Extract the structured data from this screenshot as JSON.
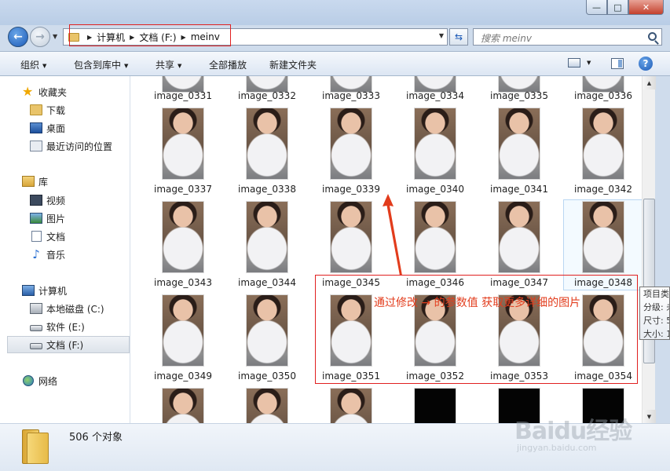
{
  "window": {
    "min_label": "—",
    "max_label": "□",
    "close_label": "✕"
  },
  "nav": {
    "breadcrumbs": [
      "计算机",
      "文档 (F:)",
      "meinv"
    ],
    "search_placeholder": "搜索 meinv"
  },
  "toolbar": {
    "organize": "组织",
    "include_in_library": "包含到库中",
    "share": "共享",
    "play_all": "全部播放",
    "new_folder": "新建文件夹",
    "help": "?"
  },
  "sidebar": {
    "favorites": "收藏夹",
    "downloads": "下载",
    "desktop": "桌面",
    "recent_places": "最近访问的位置",
    "libraries": "库",
    "videos": "视频",
    "pictures": "图片",
    "documents": "文档",
    "music": "音乐",
    "computer": "计算机",
    "local_disk_c": "本地磁盘 (C:)",
    "software_e": "软件 (E:)",
    "documents_f": "文档 (F:)",
    "network": "网络"
  },
  "files": [
    [
      "image_0331",
      "image_0332",
      "image_0333",
      "image_0334",
      "image_0335",
      "image_0336"
    ],
    [
      "image_0337",
      "image_0338",
      "image_0339",
      "image_0340",
      "image_0341",
      "image_0342"
    ],
    [
      "image_0343",
      "image_0344",
      "image_0345",
      "image_0346",
      "image_0347",
      "image_0348"
    ],
    [
      "image_0349",
      "image_0350",
      "image_0351",
      "image_0352",
      "image_0353",
      "image_0354"
    ]
  ],
  "tooltip": {
    "line1": "项目类",
    "line2": "分级: 未",
    "line3": "尺寸: 5",
    "line4": "大小: 1"
  },
  "annotation": {
    "text": "通过修改 → 的参数值  获取更多详细的图片"
  },
  "status": {
    "count": "506 个对象"
  },
  "watermark": {
    "logo": "Baidu经验",
    "url": "jingyan.baidu.com"
  },
  "colors": {
    "annotation_red": "#e02020",
    "accent_blue": "#1c5ab7",
    "frame": "#cfdcec"
  }
}
